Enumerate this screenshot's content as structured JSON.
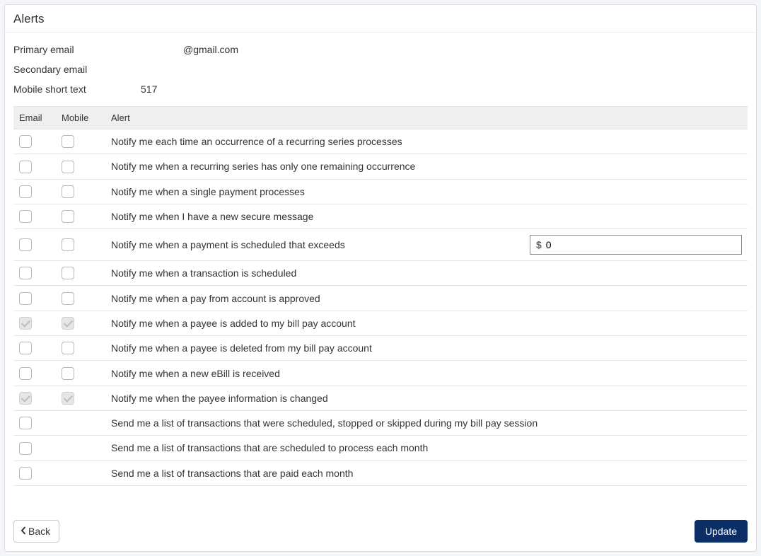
{
  "page": {
    "title": "Alerts"
  },
  "info": {
    "primary_email": {
      "label": "Primary email",
      "value": "@gmail.com"
    },
    "secondary_email": {
      "label": "Secondary email",
      "value": ""
    },
    "mobile_short": {
      "label": "Mobile short text",
      "value": "517"
    }
  },
  "columns": {
    "email": "Email",
    "mobile": "Mobile",
    "alert": "Alert"
  },
  "currency_prefix": "$",
  "rows": [
    {
      "id": "recurring-process",
      "email": false,
      "mobile": false,
      "locked": false,
      "mobile_shown": true,
      "has_amount": false,
      "text": "Notify me each time an occurrence of a recurring series processes"
    },
    {
      "id": "recurring-last",
      "email": false,
      "mobile": false,
      "locked": false,
      "mobile_shown": true,
      "has_amount": false,
      "text": "Notify me when a recurring series has only one remaining occurrence"
    },
    {
      "id": "single-payment",
      "email": false,
      "mobile": false,
      "locked": false,
      "mobile_shown": true,
      "has_amount": false,
      "text": "Notify me when a single payment processes"
    },
    {
      "id": "secure-message",
      "email": false,
      "mobile": false,
      "locked": false,
      "mobile_shown": true,
      "has_amount": false,
      "text": "Notify me when I have a new secure message"
    },
    {
      "id": "payment-exceeds",
      "email": false,
      "mobile": false,
      "locked": false,
      "mobile_shown": true,
      "has_amount": true,
      "amount": "0",
      "text": "Notify me when a payment is scheduled that exceeds"
    },
    {
      "id": "txn-scheduled",
      "email": false,
      "mobile": false,
      "locked": false,
      "mobile_shown": true,
      "has_amount": false,
      "text": "Notify me when a transaction is scheduled"
    },
    {
      "id": "payfrom-approved",
      "email": false,
      "mobile": false,
      "locked": false,
      "mobile_shown": true,
      "has_amount": false,
      "text": "Notify me when a pay from account is approved"
    },
    {
      "id": "payee-added",
      "email": true,
      "mobile": true,
      "locked": true,
      "mobile_shown": true,
      "has_amount": false,
      "text": "Notify me when a payee is added to my bill pay account"
    },
    {
      "id": "payee-deleted",
      "email": false,
      "mobile": false,
      "locked": false,
      "mobile_shown": true,
      "has_amount": false,
      "text": "Notify me when a payee is deleted from my bill pay account"
    },
    {
      "id": "ebill-received",
      "email": false,
      "mobile": false,
      "locked": false,
      "mobile_shown": true,
      "has_amount": false,
      "text": "Notify me when a new eBill is received"
    },
    {
      "id": "payee-changed",
      "email": true,
      "mobile": true,
      "locked": true,
      "mobile_shown": true,
      "has_amount": false,
      "text": "Notify me when the payee information is changed"
    },
    {
      "id": "session-list",
      "email": false,
      "mobile": false,
      "locked": false,
      "mobile_shown": false,
      "has_amount": false,
      "text": "Send me a list of transactions that were scheduled, stopped or skipped during my bill pay session"
    },
    {
      "id": "monthly-scheduled",
      "email": false,
      "mobile": false,
      "locked": false,
      "mobile_shown": false,
      "has_amount": false,
      "text": "Send me a list of transactions that are scheduled to process each month"
    },
    {
      "id": "monthly-paid",
      "email": false,
      "mobile": false,
      "locked": false,
      "mobile_shown": false,
      "has_amount": false,
      "text": "Send me a list of transactions that are paid each month"
    }
  ],
  "buttons": {
    "back": "Back",
    "update": "Update"
  }
}
